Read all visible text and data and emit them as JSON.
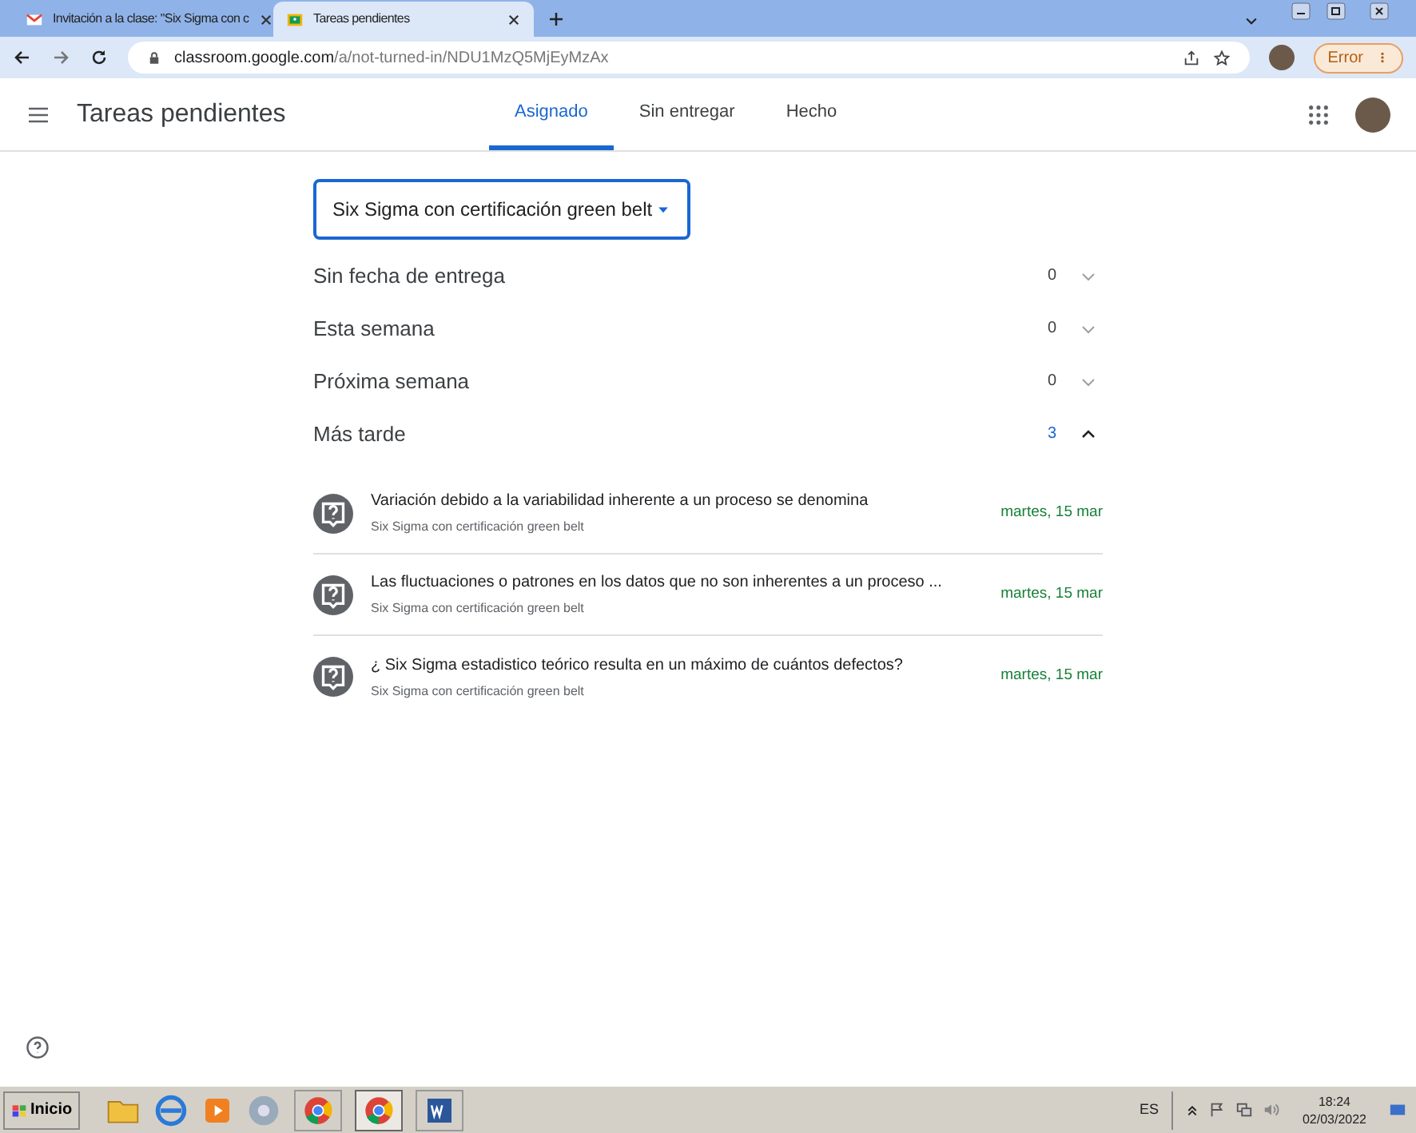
{
  "browser": {
    "tabs": [
      {
        "title": "Invitación a la clase: \"Six Sigma con c",
        "selected": false,
        "kind": "mail"
      },
      {
        "title": "Tareas pendientes",
        "selected": true,
        "kind": "classroom"
      }
    ],
    "url_host": "classroom.google.com",
    "url_path": "/a/not-turned-in/NDU1MzQ5MjEyMzAx",
    "profile_status": "Error"
  },
  "header": {
    "title": "Tareas pendientes",
    "tabs": [
      {
        "label": "Asignado",
        "selected": true
      },
      {
        "label": "Sin entregar",
        "selected": false
      },
      {
        "label": "Hecho",
        "selected": false
      }
    ]
  },
  "class_select": {
    "value": "Six Sigma con certificación green belt"
  },
  "sections": [
    {
      "label": "Sin fecha de entrega",
      "count": "0",
      "expanded": false
    },
    {
      "label": "Esta semana",
      "count": "0",
      "expanded": false
    },
    {
      "label": "Próxima semana",
      "count": "0",
      "expanded": false
    },
    {
      "label": "Más tarde",
      "count": "3",
      "expanded": true,
      "items": [
        {
          "title": "Variación debido a la variabilidad inherente a un proceso se denomina",
          "class": "Six Sigma con certificación green belt",
          "due": "martes, 15 mar"
        },
        {
          "title": "Las fluctuaciones o patrones en los datos que no son inherentes a un proceso ...",
          "class": "Six Sigma con certificación green belt",
          "due": "martes, 15 mar"
        },
        {
          "title": "¿ Six Sigma estadistico teórico resulta en un máximo de cuántos defectos?",
          "class": "Six Sigma con certificación green belt",
          "due": "martes, 15 mar"
        }
      ]
    }
  ],
  "taskbar": {
    "start": "Inicio",
    "language": "ES",
    "time": "18:24",
    "date": "02/03/2022"
  }
}
